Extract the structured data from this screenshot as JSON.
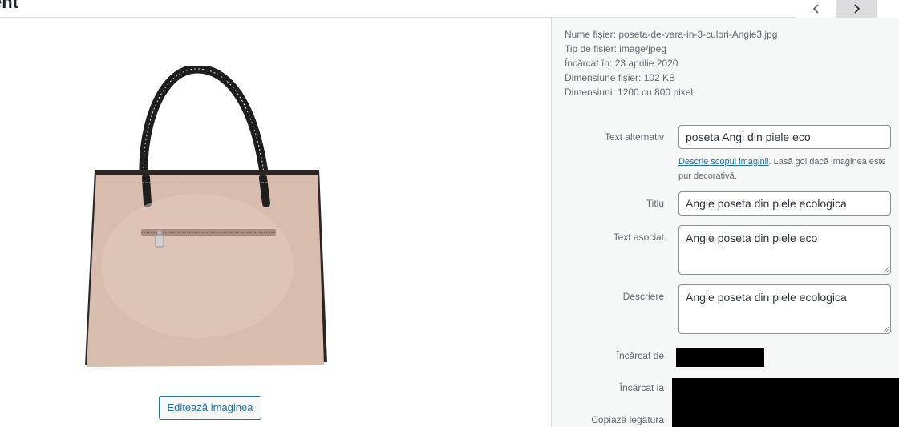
{
  "header": {
    "title_fragment": "ent",
    "prev_icon": "chevron-left-icon",
    "next_icon": "chevron-right-icon"
  },
  "media": {
    "edit_button_label": "Editează imaginea",
    "image_subject": "bag-image"
  },
  "file_info": {
    "name": "Nume fișier: poseta-de-vara-in-3-culori-Angie3.jpg",
    "type": "Tip de fișier: image/jpeg",
    "uploaded": "Încărcat în: 23 aprilie 2020",
    "size": "Dimensiune fișier: 102 KB",
    "dimensions": "Dimensiuni: 1200 cu 800 pixeli"
  },
  "fields": {
    "alt_label": "Text alternativ",
    "alt_value": "poseta Angi din piele eco",
    "alt_help_link": "Descrie scopul imaginii",
    "alt_help_text": ". Lasă gol dacă imaginea este pur decorativă.",
    "title_label": "Titlu",
    "title_value": "Angie poseta din piele ecologica",
    "caption_label": "Text asociat",
    "caption_value": "Angie poseta din piele eco",
    "description_label": "Descriere",
    "description_value": "Angie poseta din piele ecologica",
    "uploaded_by_label": "Încărcat de",
    "uploaded_to_label": "Încărcat la",
    "copy_link_label": "Copiază legătura"
  },
  "colors": {
    "accent": "#2271b1",
    "sidebar_bg": "#f6f7f7",
    "bag_body": "#d8bcae",
    "bag_handle": "#1e1e1e"
  }
}
